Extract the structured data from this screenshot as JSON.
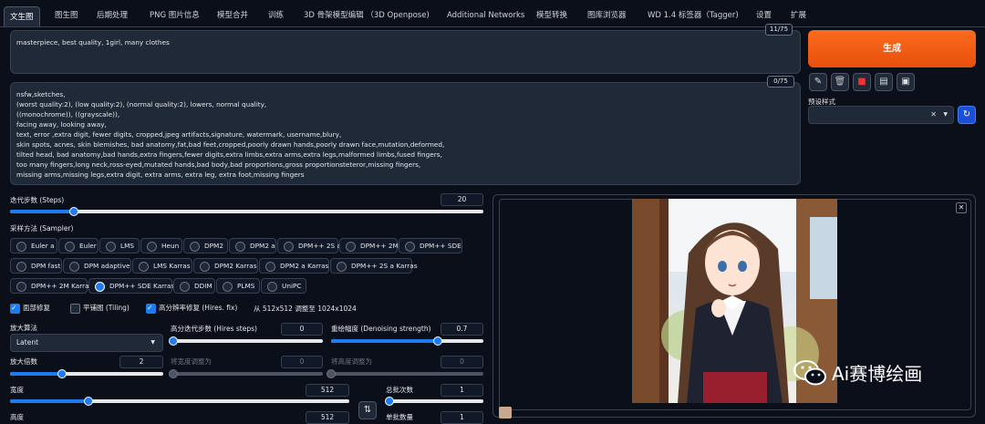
{
  "tabs": [
    "文生图",
    "图生图",
    "后期处理",
    "PNG 图片信息",
    "模型合并",
    "训练",
    "3D 骨架模型编辑 （3D Openpose)",
    "Additional Networks",
    "模型转换",
    "图库浏览器",
    "WD 1.4 标签器（Tagger)",
    "设置",
    "扩展"
  ],
  "prompt": {
    "text": "masterpiece, best quality, 1girl, many clothes",
    "counter": "11/75"
  },
  "negative_prompt": {
    "text": "nsfw,sketches,\n(worst quality:2), (low quality:2), (normal quality:2), lowers, normal quality,\n((monochrome)), ((grayscale)),\nfacing away, looking away,\ntext, error ,extra digit, fewer digits, cropped,jpeg artifacts,signature, watermark, username,blury,\nskin spots, acnes, skin blemishes, bad anatomy,fat,bad feet,cropped,poorly drawn hands,poorly drawn face,mutation,deformed,\ntilted head, bad anatomy,bad hands,extra fingers,fewer digits,extra limbs,extra arms,extra legs,malformed limbs,fused fingers,\ntoo many fingers,long neck,ross-eyed,mutated hands,bad body,bad proportions,gross proportionsteteror,missing fingers,\nmissing arms,missing legs,extra digit, extra arms, extra leg, extra foot,missing fingers",
    "counter": "0/75"
  },
  "generate": {
    "label": "生成"
  },
  "style": {
    "label": "预设样式",
    "tools": [
      "pencil-icon",
      "trash-icon",
      "save-style-icon",
      "clipboard-icon",
      "floppy-icon"
    ]
  },
  "steps": {
    "label": "迭代步数 (Steps)",
    "value": "20",
    "fraction": 0.2
  },
  "sampler": {
    "label": "采样方法 (Sampler)",
    "selected": "DPM++ SDE Karras",
    "rows": [
      [
        "Euler a",
        "Euler",
        "LMS",
        "Heun",
        "DPM2",
        "DPM2 a",
        "DPM++ 2S a",
        "DPM++ 2M",
        "DPM++ SDE"
      ],
      [
        "DPM fast",
        "DPM adaptive",
        "LMS Karras",
        "DPM2 Karras",
        "DPM2 a Karras",
        "DPM++ 2S a Karras"
      ],
      [
        "DPM++ 2M Karras",
        "DPM++ SDE Karras",
        "DDIM",
        "PLMS",
        "UniPC"
      ]
    ]
  },
  "options": {
    "face_restore": "面部修复",
    "tiling": "平铺图 (Tiling)",
    "hires": "高分辨率修复 (Hires. fix)",
    "resize_note": "从 512x512 调整至 1024x1024"
  },
  "upscaler": {
    "label": "放大算法",
    "value": "Latent"
  },
  "hires_steps": {
    "label": "高分迭代步数 (Hires steps)",
    "value": "0",
    "fraction": 0
  },
  "denoise": {
    "label": "重绘幅度 (Denoising strength)",
    "value": "0.7",
    "fraction": 0.7
  },
  "scale": {
    "label": "放大倍数",
    "value": "2",
    "fraction": 0.25
  },
  "resize_w": {
    "label": "将宽度调整为",
    "value": "0"
  },
  "resize_h": {
    "label": "将高度调整为",
    "value": "0"
  },
  "width": {
    "label": "宽度",
    "value": "512",
    "fraction": 0.23
  },
  "batch_count": {
    "label": "总批次数",
    "value": "1",
    "fraction": 0
  },
  "height": {
    "label": "高度",
    "value": "512"
  },
  "batch_size": {
    "label": "单批数量",
    "value": "1"
  },
  "swap_icon": "swap-icon",
  "watermark": "Ai赛博绘画",
  "colors": {
    "accent": "#1d7cf2",
    "generate": "#f05a14",
    "bg": "#0b0f19",
    "panel": "#1f2937"
  }
}
